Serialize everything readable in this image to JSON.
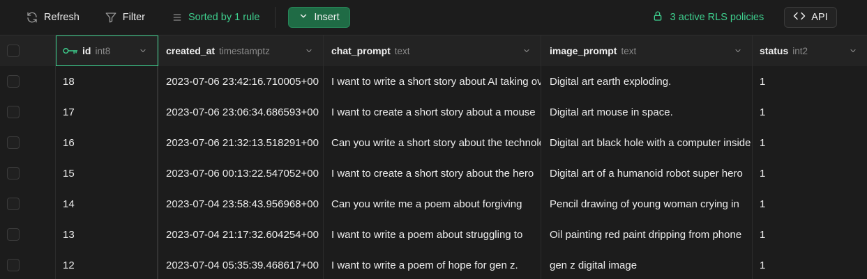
{
  "toolbar": {
    "refresh_label": "Refresh",
    "filter_label": "Filter",
    "sort_label": "Sorted by 1 rule",
    "insert_label": "Insert",
    "rls_label": "3 active RLS policies",
    "api_label": "API"
  },
  "colors": {
    "accent_green": "#3ecf8e",
    "insert_bg": "#1f6b45",
    "background": "#1c1c1c"
  },
  "columns": [
    {
      "name": "id",
      "type": "int8",
      "icon": "key-icon"
    },
    {
      "name": "created_at",
      "type": "timestamptz"
    },
    {
      "name": "chat_prompt",
      "type": "text"
    },
    {
      "name": "image_prompt",
      "type": "text"
    },
    {
      "name": "status",
      "type": "int2"
    }
  ],
  "rows": [
    {
      "id": "18",
      "created_at": "2023-07-06 23:42:16.710005+00",
      "chat_prompt": "I want to write a short story about AI taking over",
      "image_prompt": "Digital art earth exploding.",
      "status": "1"
    },
    {
      "id": "17",
      "created_at": "2023-07-06 23:06:34.686593+00",
      "chat_prompt": "I want to create a short story about a mouse",
      "image_prompt": "Digital art mouse in space.",
      "status": "1"
    },
    {
      "id": "16",
      "created_at": "2023-07-06 21:32:13.518291+00",
      "chat_prompt": "Can you write a short story about the technology",
      "image_prompt": "Digital art black hole with a computer inside",
      "status": "1"
    },
    {
      "id": "15",
      "created_at": "2023-07-06 00:13:22.547052+00",
      "chat_prompt": "I want to create a short story about the hero",
      "image_prompt": "Digital art of a humanoid robot super hero",
      "status": "1"
    },
    {
      "id": "14",
      "created_at": "2023-07-04 23:58:43.956968+00",
      "chat_prompt": "Can you write me a poem about forgiving",
      "image_prompt": "Pencil drawing of young woman crying in",
      "status": "1"
    },
    {
      "id": "13",
      "created_at": "2023-07-04 21:17:32.604254+00",
      "chat_prompt": "I want to write a poem about struggling to",
      "image_prompt": "Oil painting red paint dripping from phone",
      "status": "1"
    },
    {
      "id": "12",
      "created_at": "2023-07-04 05:35:39.468617+00",
      "chat_prompt": "I want to write a poem of hope for gen z.",
      "image_prompt": "gen z digital image",
      "status": "1"
    }
  ]
}
